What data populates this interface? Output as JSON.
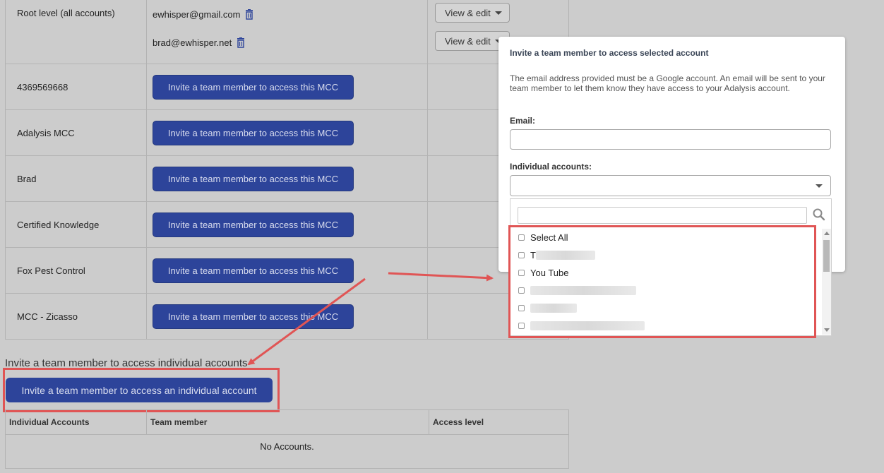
{
  "mcc_table": {
    "root": {
      "name": "Root level (all accounts)",
      "members": [
        {
          "email": "ewhisper@gmail.com",
          "access_button": "View & edit"
        },
        {
          "email": "brad@ewhisper.net",
          "access_button": "View & edit"
        }
      ]
    },
    "rows": [
      {
        "name": "4369569668",
        "button": "Invite a team member to access this MCC"
      },
      {
        "name": "Adalysis MCC",
        "button": "Invite a team member to access this MCC"
      },
      {
        "name": "Brad",
        "button": "Invite a team member to access this MCC"
      },
      {
        "name": "Certified Knowledge",
        "button": "Invite a team member to access this MCC"
      },
      {
        "name": "Fox Pest Control",
        "button": "Invite a team member to access this MCC"
      },
      {
        "name": "MCC - Zicasso",
        "button": "Invite a team member to access this MCC"
      }
    ]
  },
  "individual": {
    "heading": "Invite a team member to access individual accounts",
    "button": "Invite a team member to access an individual account",
    "columns": [
      "Individual Accounts",
      "Team member",
      "Access level"
    ],
    "empty_text": "No Accounts."
  },
  "modal": {
    "title": "Invite a team member to access selected account",
    "description": "The email address provided must be a Google account. An email will be sent to your team member to let them know they have access to your Adalysis account.",
    "email_label": "Email:",
    "email_value": "",
    "accounts_label": "Individual accounts:",
    "accounts_value": ""
  },
  "dropdown": {
    "search_value": "",
    "items": [
      {
        "label": "Select All",
        "checked": false
      },
      {
        "label": "T",
        "checked": false,
        "obscured": true
      },
      {
        "label": "You Tube",
        "checked": false
      },
      {
        "label": "",
        "checked": false,
        "obscured": true
      },
      {
        "label": "",
        "checked": false,
        "obscured": true
      },
      {
        "label": "",
        "checked": false,
        "obscured": true
      }
    ]
  },
  "colors": {
    "primary_button": "#2d449a",
    "annotation_red": "#e05555",
    "overlay": "#cccccc"
  }
}
